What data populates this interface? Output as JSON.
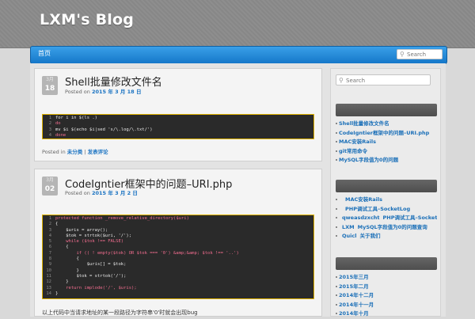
{
  "site": {
    "title": "LXM's Blog"
  },
  "nav": {
    "home_label": "首页",
    "search_placeholder": "Search"
  },
  "posts": [
    {
      "date_month": "3月",
      "date_day": "18",
      "title": "Shell批量修改文件名",
      "meta_prefix": "Posted on ",
      "meta_date": "2015 年 3 月 18 日",
      "code": [
        {
          "n": "1",
          "t": "for i in $(ls .)"
        },
        {
          "n": "2",
          "t": "do"
        },
        {
          "n": "3",
          "t": "mv $i $(echo $i|sed 's/\\.log/\\.txt/')"
        },
        {
          "n": "4",
          "t": "done"
        }
      ],
      "footer_prefix": "Posted in ",
      "footer_cat1": "未分类",
      "footer_sep": " | ",
      "footer_cat2": "发表评论"
    },
    {
      "date_month": "3月",
      "date_day": "02",
      "title": "CodeIgntier框架中的问题–URI.php",
      "meta_prefix": "Posted on ",
      "meta_date": "2015 年 3 月 2 日",
      "code": [
        {
          "n": "1",
          "t": "protected function _remove_relative_directory($uri)"
        },
        {
          "n": "2",
          "t": "{"
        },
        {
          "n": "3",
          "t": "    $uris = array();"
        },
        {
          "n": "4",
          "t": "    $tok = strtok($uri, '/');"
        },
        {
          "n": "5",
          "t": "    while ($tok !== FALSE)"
        },
        {
          "n": "6",
          "t": "    {"
        },
        {
          "n": "7",
          "t": "        if (( ! empty($tok) OR $tok === '0') &amp;&amp; $tok !== '..')"
        },
        {
          "n": "8",
          "t": "        {"
        },
        {
          "n": "9",
          "t": "            $uris[] = $tok;"
        },
        {
          "n": "10",
          "t": "        }"
        },
        {
          "n": "11",
          "t": "        $tok = strtok('/');"
        },
        {
          "n": "12",
          "t": "    }"
        },
        {
          "n": "13",
          "t": "    return implode('/', $uris);"
        },
        {
          "n": "14",
          "t": "}"
        }
      ],
      "excerpt": "以上代码中当请求地址的某一段路径为字符串'0'时就会出现bug"
    }
  ],
  "sidebar": {
    "search_placeholder": "Search",
    "recent_posts": [
      "Shell批量修改文件名",
      "CodeIgntier框架中的问题–URI.php",
      "MAC安装Rails",
      "git常用命令",
      "MySQL字段值为0的问题"
    ],
    "recent_comments": [
      {
        "author": "",
        "text": "MAC安装Rails"
      },
      {
        "author": "",
        "text": "PHP调试工具–SocketLog"
      },
      {
        "author": "qweasdzxcht",
        "text": "PHP调试工具–SocketLog"
      },
      {
        "author": "LXM",
        "text": "MySQL字段值为0的问题查询"
      },
      {
        "author": "Quicl",
        "text": "关于我们"
      }
    ],
    "archives": [
      "2015年三月",
      "2015年二月",
      "2014年十二月",
      "2014年十一月",
      "2014年十月"
    ]
  },
  "colors": {
    "accent": "#1a73c2",
    "nav": "#1f86d6",
    "code_bg": "#2a2a2a",
    "code_border": "#e0b300"
  }
}
